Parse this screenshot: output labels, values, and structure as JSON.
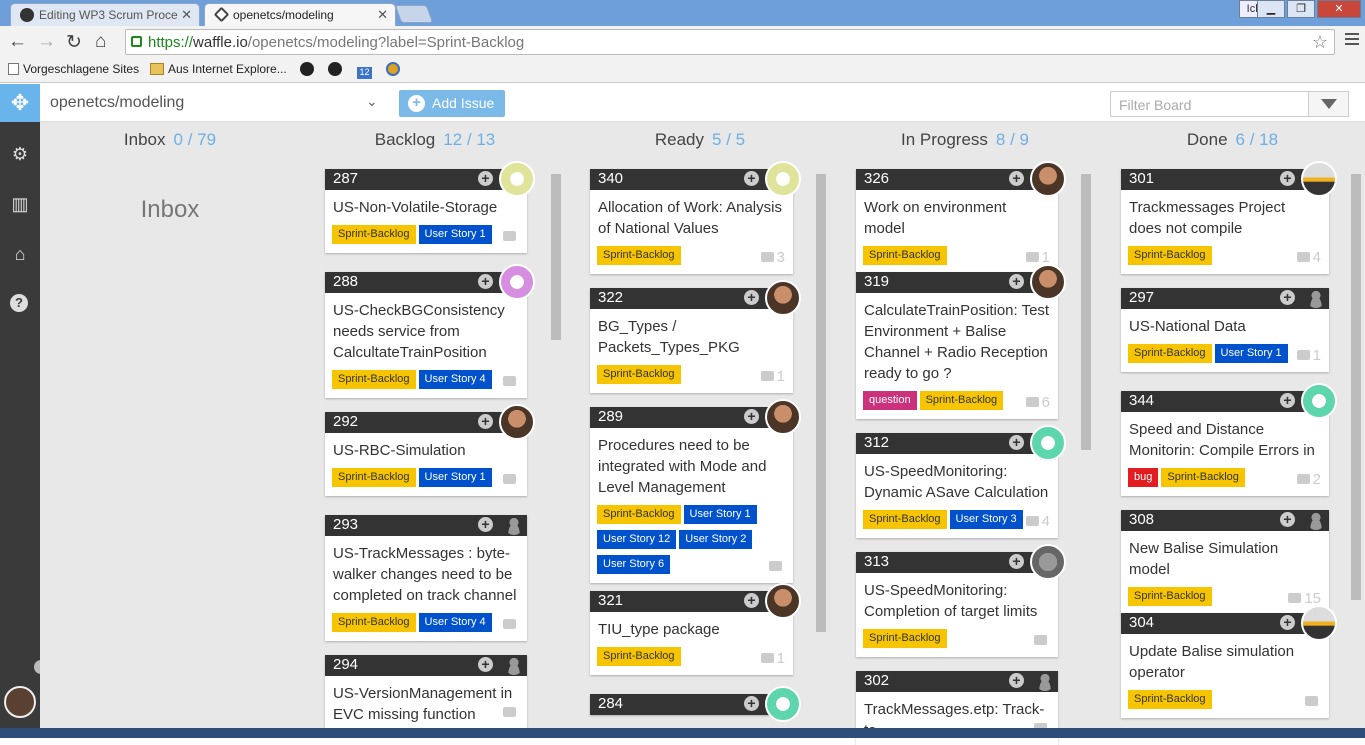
{
  "browser": {
    "tabs": [
      {
        "title": "Editing WP3 Scrum Proce",
        "active": false
      },
      {
        "title": "openetcs/modeling",
        "active": true
      }
    ],
    "user_button": "Ich",
    "url_https": "https://",
    "url_host": "waffle.io",
    "url_rest": "/openetcs/modeling?label=Sprint-Backlog",
    "bookmarks": [
      "Vorgeschlagene Sites",
      "Aus Internet Explore...",
      "12"
    ]
  },
  "app": {
    "repo": "openetcs/modeling",
    "add_issue": "Add Issue",
    "filter_placeholder": "Filter Board",
    "inbox_big": "Inbox",
    "colors": {
      "accent": "#6eb0e6",
      "sprint_backlog": "#f6c500",
      "user_story": "#0052cc",
      "question": "#cc317c",
      "bug": "#e11d21"
    }
  },
  "columns": [
    {
      "name": "Inbox",
      "count": "0 / 79"
    },
    {
      "name": "Backlog",
      "count": "12 / 13"
    },
    {
      "name": "Ready",
      "count": "5 / 5"
    },
    {
      "name": "In Progress",
      "count": "8 / 9"
    },
    {
      "name": "Done",
      "count": "6 / 18"
    }
  ],
  "cards": {
    "backlog": [
      {
        "num": "287",
        "title": "US-Non-Volatile-Storage",
        "labels": [
          "Sprint-Backlog",
          "User Story 1"
        ],
        "comments": ""
      },
      {
        "num": "288",
        "title": "US-CheckBGConsistency needs service from CalcultateTrainPosition",
        "labels": [
          "Sprint-Backlog",
          "User Story 4"
        ],
        "comments": ""
      },
      {
        "num": "292",
        "title": "US-RBC-Simulation",
        "labels": [
          "Sprint-Backlog",
          "User Story 1"
        ],
        "comments": ""
      },
      {
        "num": "293",
        "title": "US-TrackMessages : byte-walker changes need to be completed on track channel",
        "labels": [
          "Sprint-Backlog",
          "User Story 4"
        ],
        "comments": ""
      },
      {
        "num": "294",
        "title": "US-VersionManagement in EVC missing function",
        "labels": [],
        "comments": ""
      }
    ],
    "ready": [
      {
        "num": "340",
        "title": "Allocation of Work: Analysis of National Values",
        "labels": [
          "Sprint-Backlog"
        ],
        "comments": "3"
      },
      {
        "num": "322",
        "title": "BG_Types / Packets_Types_PKG",
        "labels": [
          "Sprint-Backlog"
        ],
        "comments": "1"
      },
      {
        "num": "289",
        "title": "Procedures need to be integrated with Mode and Level Management",
        "labels": [
          "Sprint-Backlog",
          "User Story 1",
          "User Story 12",
          "User Story 2",
          "User Story 6"
        ],
        "comments": ""
      },
      {
        "num": "321",
        "title": "TIU_type package",
        "labels": [
          "Sprint-Backlog"
        ],
        "comments": "1"
      },
      {
        "num": "284",
        "title": "",
        "labels": [],
        "comments": ""
      }
    ],
    "inprogress": [
      {
        "num": "326",
        "title": "Work on environment model",
        "labels": [
          "Sprint-Backlog"
        ],
        "comments": "1"
      },
      {
        "num": "319",
        "title": "CalculateTrainPosition: Test Environment + Balise Channel + Radio Reception ready to go ?",
        "labels": [
          "question",
          "Sprint-Backlog"
        ],
        "comments": "6"
      },
      {
        "num": "312",
        "title": "US-SpeedMonitoring: Dynamic ASave Calculation",
        "labels": [
          "Sprint-Backlog",
          "User Story 3"
        ],
        "comments": "4"
      },
      {
        "num": "313",
        "title": "US-SpeedMonitoring: Completion of target limits",
        "labels": [
          "Sprint-Backlog"
        ],
        "comments": ""
      },
      {
        "num": "302",
        "title": "TrackMessages.etp: Track-to-",
        "labels": [],
        "comments": ""
      }
    ],
    "done": [
      {
        "num": "301",
        "title": "Trackmessages Project does not compile",
        "labels": [
          "Sprint-Backlog"
        ],
        "comments": "4"
      },
      {
        "num": "297",
        "title": "US-National Data",
        "labels": [
          "Sprint-Backlog",
          "User Story 1"
        ],
        "comments": "1"
      },
      {
        "num": "344",
        "title": "Speed and Distance Monitorin: Compile Errors in",
        "labels": [
          "bug",
          "Sprint-Backlog"
        ],
        "comments": "2"
      },
      {
        "num": "308",
        "title": "New Balise Simulation model",
        "labels": [
          "Sprint-Backlog"
        ],
        "comments": "15"
      },
      {
        "num": "304",
        "title": "Update Balise simulation operator",
        "labels": [
          "Sprint-Backlog"
        ],
        "comments": ""
      }
    ]
  }
}
